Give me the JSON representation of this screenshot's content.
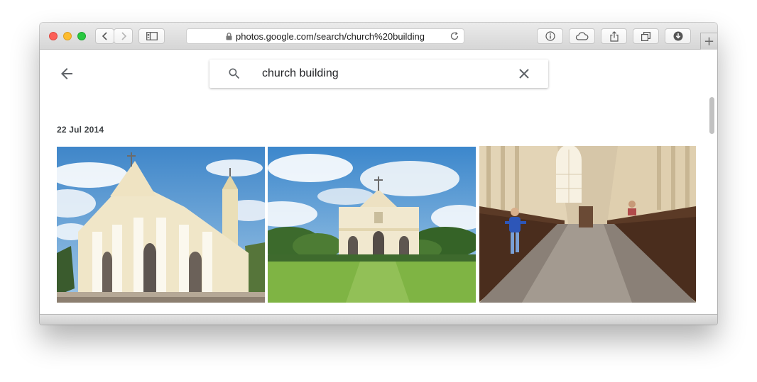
{
  "browser": {
    "url": "photos.google.com/search/church%20building",
    "new_tab_label": "+"
  },
  "search": {
    "query": "church building"
  },
  "results": {
    "date": "22 Jul 2014"
  },
  "colors": {
    "traffic_red": "#fc5f57",
    "traffic_yellow": "#fdbc2e",
    "traffic_green": "#28c840"
  }
}
